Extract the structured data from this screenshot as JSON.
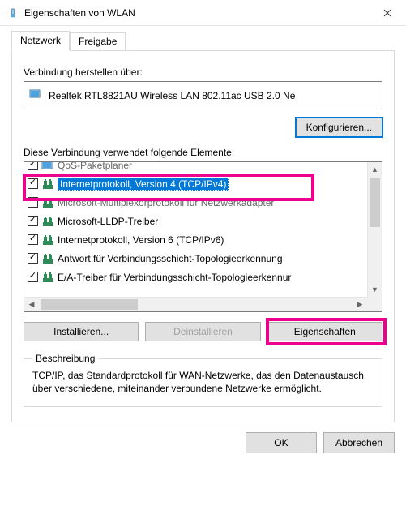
{
  "window": {
    "title": "Eigenschaften von WLAN"
  },
  "tabs": {
    "network": "Netzwerk",
    "sharing": "Freigabe"
  },
  "connect_using_label": "Verbindung herstellen über:",
  "adapter": {
    "name": "Realtek RTL8821AU Wireless LAN 802.11ac USB 2.0 Ne"
  },
  "configure_btn": "Konfigurieren...",
  "items_label": "Diese Verbindung verwendet folgende Elemente:",
  "items": [
    {
      "label": "QoS-Paketplaner",
      "checked": true,
      "selected": false,
      "icon": "nic",
      "partial": true
    },
    {
      "label": "Internetprotokoll, Version 4 (TCP/IPv4)",
      "checked": true,
      "selected": true,
      "icon": "proto"
    },
    {
      "label": "Microsoft-Multiplexorprotokoll für Netzwerkadapter",
      "checked": false,
      "selected": false,
      "icon": "proto",
      "partial": true
    },
    {
      "label": "Microsoft-LLDP-Treiber",
      "checked": true,
      "selected": false,
      "icon": "proto"
    },
    {
      "label": "Internetprotokoll, Version 6 (TCP/IPv6)",
      "checked": true,
      "selected": false,
      "icon": "proto"
    },
    {
      "label": "Antwort für Verbindungsschicht-Topologieerkennung",
      "checked": true,
      "selected": false,
      "icon": "proto"
    },
    {
      "label": "E/A-Treiber für Verbindungsschicht-Topologieerkennur",
      "checked": true,
      "selected": false,
      "icon": "proto"
    }
  ],
  "buttons": {
    "install": "Installieren...",
    "uninstall": "Deinstallieren",
    "properties": "Eigenschaften"
  },
  "description": {
    "legend": "Beschreibung",
    "body": "TCP/IP, das Standardprotokoll für WAN-Netzwerke, das den Datenaustausch über verschiedene, miteinander verbundene Netzwerke ermöglicht."
  },
  "dialog_buttons": {
    "ok": "OK",
    "cancel": "Abbrechen"
  }
}
